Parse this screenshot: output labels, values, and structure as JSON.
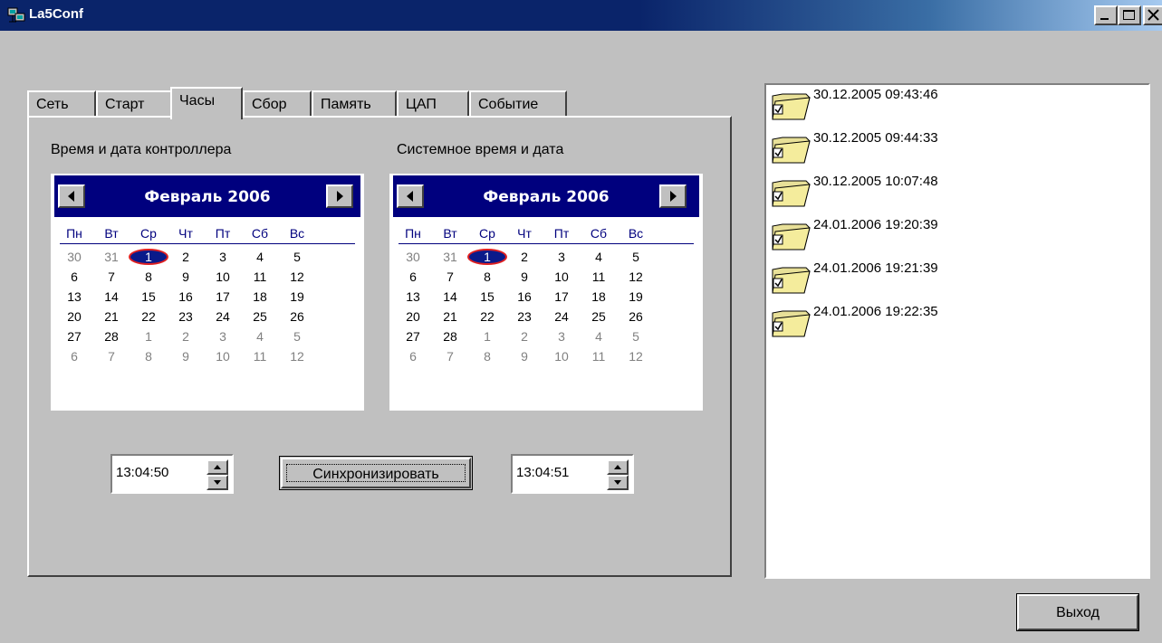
{
  "window": {
    "title": "La5Conf",
    "icons": {
      "app": "network-computer-icon",
      "minimize": "minimize-icon",
      "maximize": "maximize-icon",
      "close": "close-icon"
    }
  },
  "tabs": [
    {
      "label": "Сеть",
      "active": false
    },
    {
      "label": "Старт",
      "active": false
    },
    {
      "label": "Часы",
      "active": true
    },
    {
      "label": "Сбор",
      "active": false
    },
    {
      "label": "Память",
      "active": false
    },
    {
      "label": "ЦАП",
      "active": false
    },
    {
      "label": "Событие",
      "active": false
    }
  ],
  "clock": {
    "controller_label": "Время и дата контроллера",
    "system_label": "Системное время и дата",
    "controller_calendar": {
      "month": "Февраль 2006",
      "selected_day": "1"
    },
    "system_calendar": {
      "month": "Февраль 2006",
      "selected_day": "1"
    },
    "weekdays": [
      "Пн",
      "Вт",
      "Ср",
      "Чт",
      "Пт",
      "Сб",
      "Вс"
    ],
    "weeks": [
      [
        "30",
        "31",
        "1",
        "2",
        "3",
        "4",
        "5"
      ],
      [
        "6",
        "7",
        "8",
        "9",
        "10",
        "11",
        "12"
      ],
      [
        "13",
        "14",
        "15",
        "16",
        "17",
        "18",
        "19"
      ],
      [
        "20",
        "21",
        "22",
        "23",
        "24",
        "25",
        "26"
      ],
      [
        "27",
        "28",
        "1",
        "2",
        "3",
        "4",
        "5"
      ],
      [
        "6",
        "7",
        "8",
        "9",
        "10",
        "11",
        "12"
      ]
    ],
    "controller_time": "13:04:50",
    "system_time": "13:04:51",
    "sync_button": "Синхронизировать"
  },
  "events": [
    "30.12.2005 09:43:46",
    "30.12.2005 09:44:33",
    "30.12.2005 10:07:48",
    "24.01.2006 19:20:39",
    "24.01.2006 19:21:39",
    "24.01.2006 19:22:35"
  ],
  "exit_button": "Выход",
  "colors": {
    "calendar_header": "#00007e",
    "selection": "#0a1a8a",
    "selection_ring": "#e02020",
    "window_face": "#c0c0c0"
  }
}
